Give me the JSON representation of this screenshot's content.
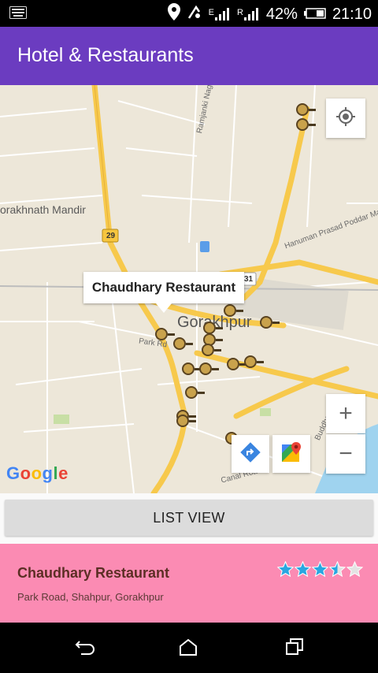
{
  "status_bar": {
    "battery_percent": "42%",
    "time": "21:10",
    "icons": [
      "keyboard-icon",
      "location-icon",
      "headset-icon",
      "signal-e-icon",
      "signal-r-icon",
      "battery-icon"
    ],
    "network_a": "E",
    "network_b": "R"
  },
  "app_bar": {
    "title": "Hotel & Restaurants",
    "color": "#6b3cc0"
  },
  "map": {
    "labels": {
      "gorakhnath": "orakhnath Mandir",
      "city": "Gorakhpur",
      "ramjanki": "Ramjanki Nagar Rd",
      "hanuman": "Hanuman Prasad Poddar Marg",
      "park_rd": "Park Rd",
      "canal_rd": "Canal Road",
      "buddha": "Buddha Vih",
      "route_29": "29",
      "route_31": "31"
    },
    "info_window": "Chaudhary Restaurant",
    "google": {
      "G": "G",
      "o1": "o",
      "o2": "o",
      "g": "g",
      "l": "l",
      "e": "e"
    },
    "controls": {
      "zoom_in": "+",
      "zoom_out": "−"
    }
  },
  "list_view_button": "LIST VIEW",
  "card": {
    "name": "Chaudhary Restaurant",
    "address": "Park Road, Shahpur, Gorakhpur",
    "rating": 3.5,
    "max_rating": 5,
    "color": "#fb8bb3"
  },
  "colors": {
    "star": "#29a7e1",
    "star_empty": "#e3e3e3",
    "pin": "#c9a24c"
  }
}
